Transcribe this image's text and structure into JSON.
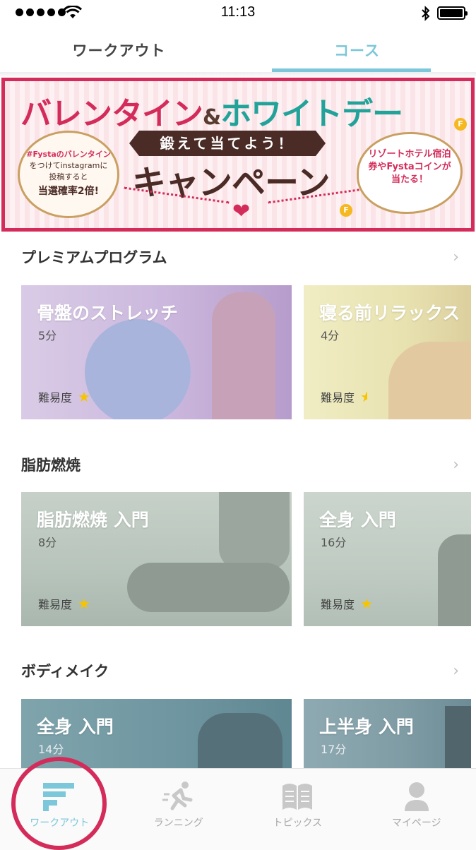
{
  "status_bar": {
    "time": "11:13"
  },
  "top_tabs": {
    "workout": "ワークアウト",
    "course": "コース",
    "active": "course"
  },
  "banner": {
    "title_part1": "バレンタイン",
    "title_amp": "&",
    "title_part2": "ホワイトデー",
    "ribbon": "鍛えて当てよう！",
    "campaign": "キャンペーン",
    "badge_line1": "#Fystaのバレンタイン",
    "badge_line2": "をつけてinstagramに",
    "badge_line3": "投稿すると",
    "badge_line4": "当選確率2倍!",
    "cloud_text": "リゾートホテル宿泊券やFystaコインが当たる！",
    "coin_letter": "F",
    "border_color": "#d42c5a"
  },
  "sections": [
    {
      "title": "プレミアムプログラム",
      "cards": [
        {
          "title": "骨盤のストレッチ",
          "duration": "5分",
          "difficulty_label": "難易度",
          "difficulty": 1
        },
        {
          "title": "寝る前リラックス",
          "duration": "4分",
          "difficulty_label": "難易度",
          "difficulty": 0.5
        }
      ]
    },
    {
      "title": "脂肪燃焼",
      "cards": [
        {
          "title": "脂肪燃焼 入門",
          "duration": "8分",
          "difficulty_label": "難易度",
          "difficulty": 1
        },
        {
          "title": "全身 入門",
          "duration": "16分",
          "difficulty_label": "難易度",
          "difficulty": 1
        }
      ]
    },
    {
      "title": "ボディメイク",
      "cards": [
        {
          "title": "全身 入門",
          "duration": "14分"
        },
        {
          "title": "上半身 入門",
          "duration": "17分"
        }
      ]
    }
  ],
  "bottom_nav": [
    {
      "label": "ワークアウト",
      "icon": "workout-icon",
      "active": true
    },
    {
      "label": "ランニング",
      "icon": "running-icon",
      "active": false
    },
    {
      "label": "トピックス",
      "icon": "book-icon",
      "active": false
    },
    {
      "label": "マイページ",
      "icon": "person-icon",
      "active": false
    }
  ],
  "colors": {
    "accent": "#7cc7d9",
    "highlight": "#d42c5a",
    "star": "#f6c400"
  }
}
